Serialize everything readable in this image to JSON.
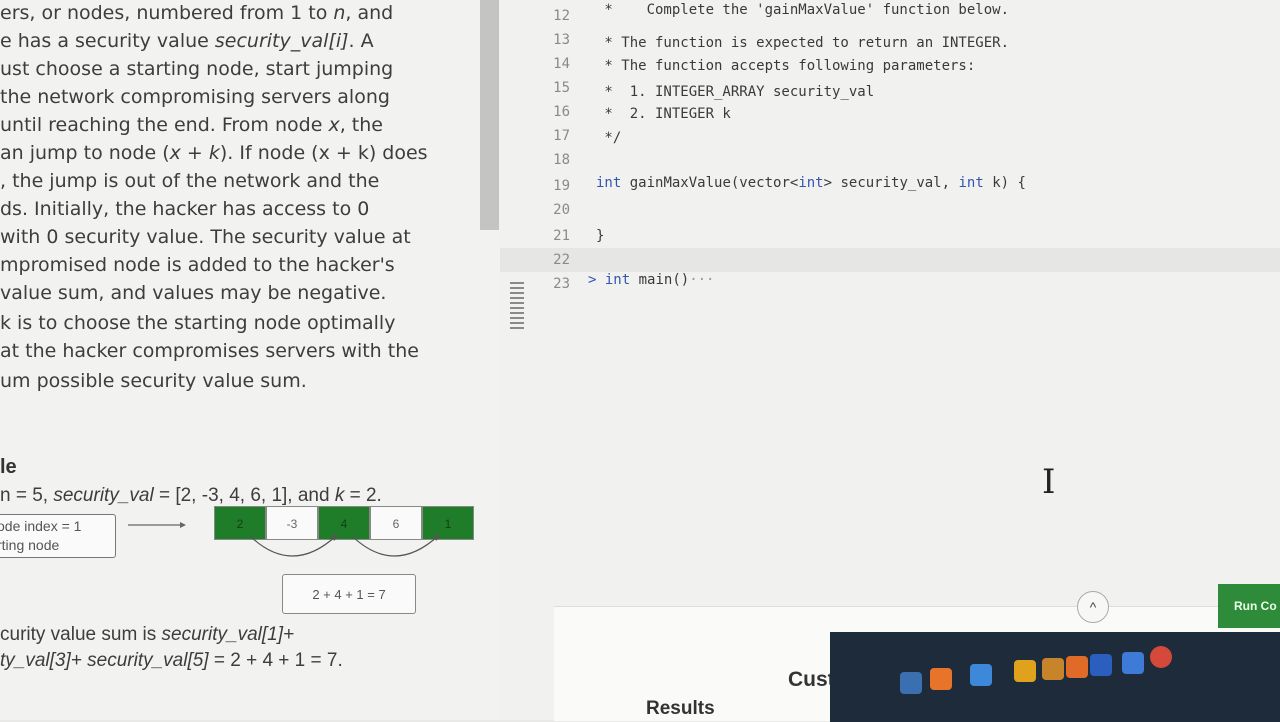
{
  "problem": {
    "lines": [
      {
        "pre": "ers, or nodes, numbered from 1 to ",
        "it": "n",
        "post": ", and"
      },
      {
        "pre": "e has a security value ",
        "it": "security_val[i]",
        "post": ". A"
      },
      {
        "pre": "ust choose a starting node, start jumping",
        "it": "",
        "post": ""
      },
      {
        "pre": "the network compromising servers along",
        "it": "",
        "post": ""
      },
      {
        "pre": "until reaching the end. From node ",
        "it": "x",
        "post": ", the"
      },
      {
        "pre": "an jump to node (",
        "it": "x + k",
        "post": "). If node (x + k) does"
      },
      {
        "pre": ", the jump is out of the network and the",
        "it": "",
        "post": ""
      },
      {
        "pre": "ds. Initially, the hacker has access to 0",
        "it": "",
        "post": ""
      },
      {
        "pre": "with 0 security value. The security value at",
        "it": "",
        "post": ""
      },
      {
        "pre": "mpromised node is added to the hacker's",
        "it": "",
        "post": ""
      },
      {
        "pre": " value sum, and values may be negative.",
        "it": "",
        "post": ""
      },
      {
        "pre": "k is to choose the starting node optimally",
        "it": "",
        "post": ""
      },
      {
        "pre": "at the hacker compromises servers with the",
        "it": "",
        "post": ""
      },
      {
        "pre": "um possible security value sum.",
        "it": "",
        "post": ""
      }
    ],
    "example_title": "le",
    "example_pre": "n = 5, ",
    "example_it": "security_val",
    "example_post": " = [2, -3, 4, 6, 1], and ",
    "example_k_it": "k",
    "example_k_post": " = 2.",
    "start_box_line1": "ode index = 1",
    "start_box_line2": "rting node",
    "cells": [
      "2",
      "-3",
      "4",
      "6",
      "1"
    ],
    "sum_box": "2 + 4 + 1 = 7",
    "bottom_line1_pre": "curity value sum is ",
    "bottom_line1_it": "security_val[1]+",
    "bottom_line2_it": "ty_val[3]+ security_val[5]",
    "bottom_line2_post": " = 2 + 4 + 1 = 7."
  },
  "editor": {
    "line_numbers": [
      "12",
      "13",
      "14",
      "15",
      "16",
      "17",
      "18",
      "19",
      "20",
      "21",
      "22",
      "23"
    ],
    "code": {
      "l12": " *    Complete the 'gainMaxValue' function below.",
      "l13": " * The function is expected to return an INTEGER.",
      "l14": " * The function accepts following parameters:",
      "l15": " *  1. INTEGER_ARRAY security_val",
      "l16": " *  2. INTEGER k",
      "l17": " */",
      "l18": "",
      "l19_kw": "int",
      "l19_rest": " gainMaxValue(vector<",
      "l19_kw2": "int",
      "l19_rest2": "> security_val, ",
      "l19_kw3": "int",
      "l19_rest3": " k) {",
      "l20": "",
      "l21": "}",
      "l22": "",
      "l23_fold": ">",
      "l23_kw": "int",
      "l23_rest": " main()",
      "l23_ellipsis": "···"
    },
    "collapse_label": "^",
    "tab_results": "Results",
    "tab_custom_input": "Custom Input",
    "run_button": "Run Co"
  },
  "colors": {
    "accent_green": "#1f7d2a",
    "keyword_blue": "#3256b0",
    "run_green": "#2e8b3a"
  }
}
